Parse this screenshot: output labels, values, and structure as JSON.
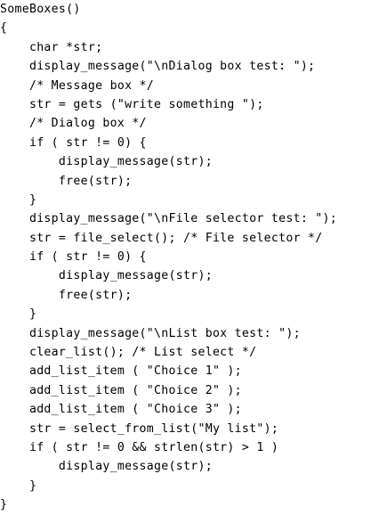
{
  "code": {
    "lines": [
      "SomeBoxes()",
      "{",
      "    char *str;",
      "    display_message(\"\\nDialog box test: \");",
      "    /* Message box */",
      "    str = gets (\"write something \");",
      "    /* Dialog box */",
      "    if ( str != 0) {",
      "        display_message(str);",
      "        free(str);",
      "    }",
      "    display_message(\"\\nFile selector test: \");",
      "    str = file_select(); /* File selector */",
      "    if ( str != 0) {",
      "        display_message(str);",
      "        free(str);",
      "    }",
      "    display_message(\"\\nList box test: \");",
      "    clear_list(); /* List select */",
      "    add_list_item ( \"Choice 1\" );",
      "    add_list_item ( \"Choice 2\" );",
      "    add_list_item ( \"Choice 3\" );",
      "    str = select_from_list(\"My list\");",
      "    if ( str != 0 && strlen(str) > 1 )",
      "        display_message(str);",
      "    }",
      "}"
    ]
  }
}
